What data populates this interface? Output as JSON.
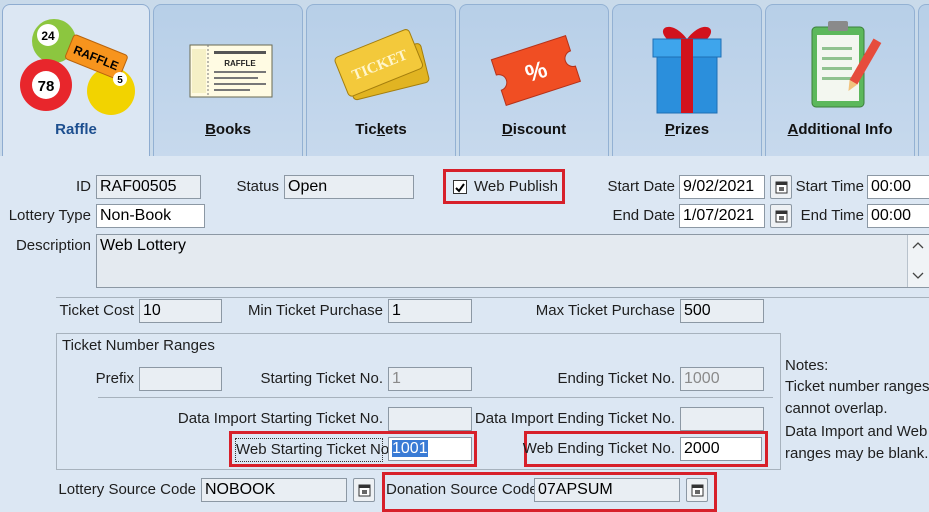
{
  "tabs": [
    {
      "label": "Raffle",
      "icon": "raffle-balls-icon"
    },
    {
      "label": "Books",
      "icon": "ticket-book-icon"
    },
    {
      "label": "Tickets",
      "icon": "tickets-icon"
    },
    {
      "label": "Discount",
      "icon": "discount-ticket-icon"
    },
    {
      "label": "Prizes",
      "icon": "gift-box-icon"
    },
    {
      "label": "Additional Info",
      "icon": "clipboard-icon"
    }
  ],
  "raffle_balls": {
    "ball1": "24",
    "ball2": "78",
    "ball3": "5",
    "ticket": "RAFFLE"
  },
  "book_image_text": {
    "line1": "RAFFLE"
  },
  "ticket_image_text": {
    "line1": "TICKET"
  },
  "discount_symbol": "%",
  "form": {
    "id_label": "ID",
    "id_value": "RAF00505",
    "status_label": "Status",
    "status_value": "Open",
    "web_publish_label": "Web Publish",
    "web_publish_checked": true,
    "start_date_label": "Start Date",
    "start_date_value": "9/02/2021",
    "start_time_label": "Start Time",
    "start_time_value": "00:00",
    "lottery_type_label": "Lottery Type",
    "lottery_type_value": "Non-Book",
    "end_date_label": "End Date",
    "end_date_value": "1/07/2021",
    "end_time_label": "End Time",
    "end_time_value": "00:00",
    "description_label": "Description",
    "description_value": "Web Lottery",
    "ticket_cost_label": "Ticket Cost",
    "ticket_cost_value": "10",
    "min_purchase_label": "Min Ticket Purchase",
    "min_purchase_value": "1",
    "max_purchase_label": "Max Ticket Purchase",
    "max_purchase_value": "500",
    "ranges_title": "Ticket Number Ranges",
    "prefix_label": "Prefix",
    "prefix_value": "",
    "starting_label": "Starting Ticket No.",
    "starting_value": "1",
    "ending_label": "Ending Ticket No.",
    "ending_value": "1000",
    "di_start_label": "Data Import Starting Ticket No.",
    "di_start_value": "",
    "di_end_label": "Data Import Ending Ticket No.",
    "di_end_value": "",
    "web_start_label": "Web Starting Ticket No.",
    "web_start_value": "1001",
    "web_end_label": "Web Ending Ticket No.",
    "web_end_value": "2000",
    "lottery_source_label": "Lottery Source Code",
    "lottery_source_value": "NOBOOK",
    "donation_source_label": "Donation Source Code",
    "donation_source_value": "07APSUM"
  },
  "notes": {
    "title": "Notes:",
    "line1": "Ticket number ranges",
    "line2": "cannot overlap.",
    "line3": "Data Import and Web",
    "line4": "ranges may be blank."
  },
  "colors": {
    "highlight_border": "#d7202a",
    "tab_active_text": "#1d4f8f",
    "selection": "#3a7bd5"
  }
}
